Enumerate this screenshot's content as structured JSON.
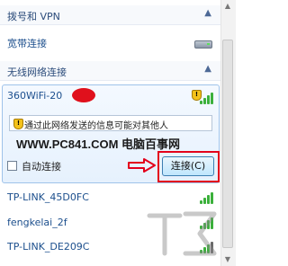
{
  "dialup_section": {
    "title": "拨号和 VPN",
    "caret": "▲"
  },
  "broadband": {
    "label": "宽带连接",
    "icon": "network-drive-icon"
  },
  "wireless_section": {
    "title": "无线网络连接",
    "caret": "▲"
  },
  "selected_network": {
    "name": "360WiFi-20",
    "security_icon": "shield-warning-icon",
    "warning": "通过此网络发送的信息可能对其他人",
    "watermark": "WWW.PC841.COM 电脑百事网",
    "auto_connect_label": "自动连接",
    "auto_connect_checked": false,
    "connect_button_label": "连接(C)"
  },
  "networks": [
    {
      "name": "TP-LINK_45D0FC",
      "signal_bars": 4
    },
    {
      "name": "fengkelai_2f",
      "signal_bars": 4
    },
    {
      "name": "TP-LINK_DE209C",
      "signal_bars": 3
    }
  ],
  "colors": {
    "highlight": "#e3001b",
    "link_text": "#1c4f8d",
    "signal_green": "#3bb03b"
  }
}
